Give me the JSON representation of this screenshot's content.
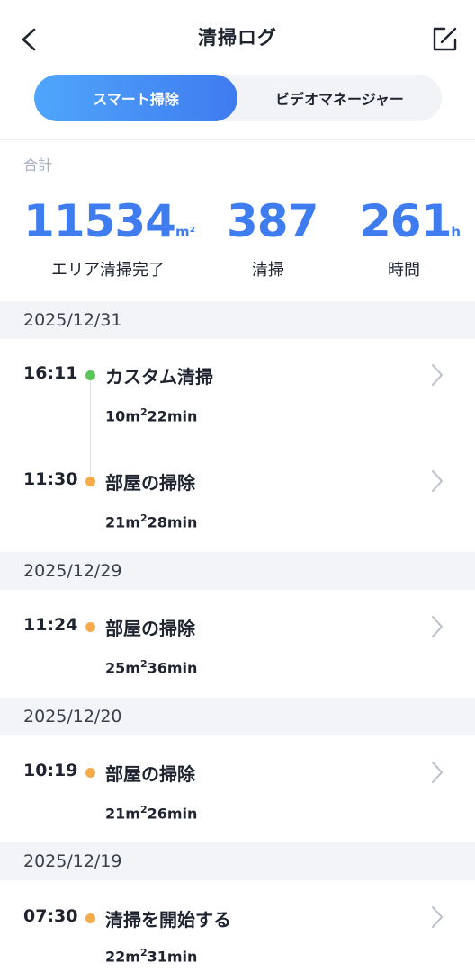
{
  "header": {
    "title": "清掃ログ",
    "back_icon": "chevron-left-icon",
    "edit_icon": "edit-square-icon"
  },
  "tabs": [
    {
      "label": "スマート掃除",
      "active": true
    },
    {
      "label": "ビデオマネージャー",
      "active": false
    }
  ],
  "totals": {
    "label": "合計",
    "stats": [
      {
        "value": "11534",
        "unit": "m²",
        "label": "エリア清掃完了"
      },
      {
        "value": "387",
        "unit": "",
        "label": "清掃"
      },
      {
        "value": "261",
        "unit": "h",
        "label": "時間"
      }
    ]
  },
  "groups": [
    {
      "date": "2025/12/31",
      "entries": [
        {
          "time": "16:11",
          "title": "カスタム清掃",
          "area": "10m",
          "area_sup": "2",
          "duration": "22min",
          "dot": "green"
        },
        {
          "time": "11:30",
          "title": "部屋の掃除",
          "area": "21m",
          "area_sup": "2",
          "duration": "28min",
          "dot": "orange"
        }
      ]
    },
    {
      "date": "2025/12/29",
      "entries": [
        {
          "time": "11:24",
          "title": "部屋の掃除",
          "area": "25m",
          "area_sup": "2",
          "duration": "36min",
          "dot": "orange"
        }
      ]
    },
    {
      "date": "2025/12/20",
      "entries": [
        {
          "time": "10:19",
          "title": "部屋の掃除",
          "area": "21m",
          "area_sup": "2",
          "duration": "26min",
          "dot": "orange"
        }
      ]
    },
    {
      "date": "2025/12/19",
      "entries": [
        {
          "time": "07:30",
          "title": "清掃を開始する",
          "area": "22m",
          "area_sup": "2",
          "duration": "31min",
          "dot": "orange"
        }
      ]
    }
  ],
  "colors": {
    "accent": "#3f7cf0",
    "dot_green": "#5bc55a",
    "dot_orange": "#f5ab4a"
  }
}
